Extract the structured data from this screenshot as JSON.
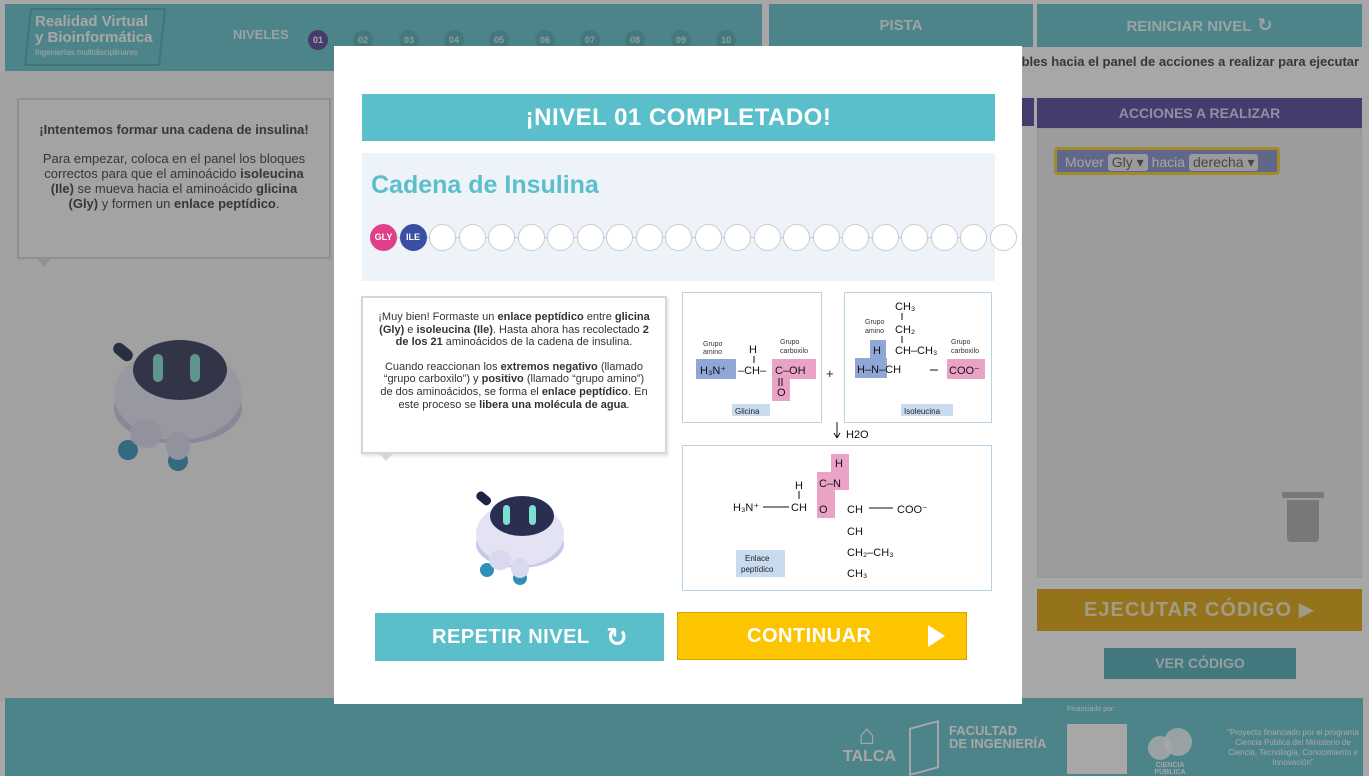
{
  "header": {
    "logo_line1": "Realidad Virtual",
    "logo_line2": "y Bioinformática",
    "logo_line3": "Ingenierías multidisciplinares",
    "levels_label": "NIVELES",
    "levels": [
      "01",
      "02",
      "03",
      "04",
      "05",
      "06",
      "07",
      "08",
      "09",
      "10"
    ],
    "active_level": "01"
  },
  "toolbar": {
    "pista_label": "PISTA",
    "reiniciar_label": "REINICIAR NIVEL",
    "instruction_text": "ibles hacia el panel de acciones a realizar para ejecutar"
  },
  "tip": {
    "title": "¡Intentemos formar una cadena de insulina!",
    "body_pre": "Para empezar, coloca en el panel los bloques correctos para que el aminoácido ",
    "body_b1": "isoleucina (Ile)",
    "body_mid": " se mueva hacia el aminoácido ",
    "body_b2": "glicina (Gly)",
    "body_mid2": " y formen un ",
    "body_b3": "enlace peptídico",
    "body_end": "."
  },
  "actions": {
    "header": "ACCIONES A REALIZAR",
    "block_verb": "Mover",
    "block_object": "Gly",
    "block_prep": "hacia",
    "block_direction": "derecha"
  },
  "buttons": {
    "ejecutar": "EJECUTAR  CÓDIGO",
    "ver_codigo": "VER CÓDIGO"
  },
  "footer": {
    "talca": "TALCA",
    "facultad_line1": "FACULTAD",
    "facultad_line2": "DE INGENIERÍA",
    "financiado": "Financiado por:",
    "ciencia": "CIENCIA PÚBLICA",
    "proyecto": "\"Proyecto financiado por el programa Ciencia Pública del Ministerio de Ciencia, Tecnología, Conocimiento e Innovación\""
  },
  "modal": {
    "title": "¡NIVEL 01 COMPLETADO!",
    "chain_title": "Cadena de Insulina",
    "chain_beads": [
      "GLY",
      "ILE",
      "",
      "",
      "",
      "",
      "",
      "",
      "",
      "",
      "",
      "",
      "",
      "",
      "",
      "",
      "",
      "",
      "",
      "",
      "",
      ""
    ],
    "message": {
      "p1_a": "¡Muy bien! Formaste un ",
      "p1_b": "enlace peptídico",
      "p1_c": " entre ",
      "p1_d": "glicina (Gly)",
      "p1_e": " e ",
      "p1_f": "isoleucina (Ile)",
      "p1_g": ". Hasta ahora has recolectado ",
      "p1_h": "2 de los 21",
      "p1_i": " aminoácidos de la cadena de insulina.",
      "p2_a": "Cuando reaccionan los ",
      "p2_b": "extremos negativo",
      "p2_c": " (llamado “grupo carboxilo”) y ",
      "p2_d": "positivo",
      "p2_e": " (llamado “grupo amino”) de dos aminoácidos, se forma el ",
      "p2_f": "enlace peptídico",
      "p2_g": ". En este proceso se ",
      "p2_h": "libera una molécula de agua",
      "p2_i": "."
    },
    "diagram": {
      "grupo_amino": "Grupo amino",
      "grupo_carboxilo": "Grupo carboxilo",
      "glicina": "Glicina",
      "isoleucina": "Isoleucina",
      "enlace": "Enlace peptídico",
      "water": "H2O",
      "plus": "+"
    },
    "repetir_label": "REPETIR NIVEL",
    "continuar_label": "CONTINUAR"
  },
  "colors": {
    "teal": "#5bbfcb",
    "purple": "#4b3d96",
    "yellow": "#fcc500",
    "gly_pink": "#e0408a",
    "ile_blue": "#3a4fa3",
    "amino_blue": "#8fa6d6",
    "carboxyl_pink": "#eaa3c6"
  }
}
